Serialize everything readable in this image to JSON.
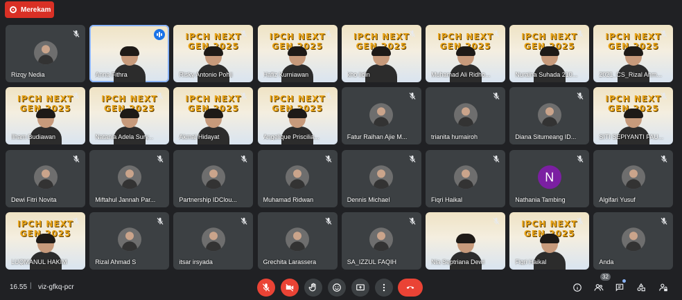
{
  "recording": {
    "label": "Merekam"
  },
  "tiles": [
    {
      "name": "Rizqy Nedia",
      "kind": "avatar",
      "mic": "muted"
    },
    {
      "name": "Anna Fithra",
      "kind": "video",
      "mic": "speaking",
      "active": true
    },
    {
      "name": "Risky Antonio Pohji",
      "kind": "video",
      "mic": "muted",
      "banner": "IPCH NEXT GEN 2025"
    },
    {
      "name": "Hafiz Kurniawan",
      "kind": "video",
      "mic": "muted",
      "banner": "IPCH NEXT GEN 2025"
    },
    {
      "name": "kho iidin",
      "kind": "video",
      "mic": "muted",
      "banner": "IPCH NEXT GEN 2025"
    },
    {
      "name": "Muhamad Ali Ridho...",
      "kind": "video",
      "mic": "muted",
      "banner": "IPCH NEXT GEN 2025"
    },
    {
      "name": "Nuraina Suhada 210...",
      "kind": "video",
      "mic": "muted",
      "banner": "IPCH NEXT GEN 2025"
    },
    {
      "name": "2021_CS_Rizal Ahm...",
      "kind": "video",
      "mic": "muted",
      "banner": "IPCH NEXT GEN 2025"
    },
    {
      "name": "Ilham Budiawan",
      "kind": "video",
      "mic": "muted",
      "banner": "IPCH NEXT GEN 2025"
    },
    {
      "name": "Natania Adela Sury...",
      "kind": "video",
      "mic": "muted",
      "banner": "IPCH NEXT GEN 2025"
    },
    {
      "name": "Akmal Hidayat",
      "kind": "video",
      "mic": "muted",
      "banner": "IPCH NEXT GEN 2025"
    },
    {
      "name": "Angelique Priscilia...",
      "kind": "video",
      "mic": "muted",
      "banner": "IPCH NEXT GEN 2025"
    },
    {
      "name": "Fatur Raihan Ajie M...",
      "kind": "avatar",
      "mic": "muted"
    },
    {
      "name": "trianita humairoh",
      "kind": "avatar",
      "mic": "muted"
    },
    {
      "name": "Diana Situmeang ID...",
      "kind": "avatar",
      "mic": "muted"
    },
    {
      "name": "SITI SEPIYANTI FAU...",
      "kind": "video",
      "mic": "muted",
      "banner": "IPCH NEXT GEN 2025"
    },
    {
      "name": "Dewi Fitri Novita",
      "kind": "avatar",
      "mic": "muted"
    },
    {
      "name": "Miftahul Jannah Par...",
      "kind": "avatar",
      "mic": "muted"
    },
    {
      "name": "Partnership IDClou...",
      "kind": "avatar",
      "mic": "muted"
    },
    {
      "name": "Muhamad Ridwan",
      "kind": "avatar",
      "mic": "muted"
    },
    {
      "name": "Dennis Michael",
      "kind": "avatar",
      "mic": "muted"
    },
    {
      "name": "Fiqri Haikal",
      "kind": "avatar",
      "mic": "muted"
    },
    {
      "name": "Nathania Tambing",
      "kind": "letter",
      "letter": "N",
      "mic": "muted"
    },
    {
      "name": "Algifari Yusuf",
      "kind": "avatar",
      "mic": "muted"
    },
    {
      "name": "LUQMANUL HAKIM",
      "kind": "video",
      "mic": "muted",
      "banner": "IPCH NEXT GEN 2025"
    },
    {
      "name": "Rizal Ahmad S",
      "kind": "avatar",
      "mic": "muted"
    },
    {
      "name": "itsar irsyada",
      "kind": "avatar",
      "mic": "muted"
    },
    {
      "name": "Grechita Larassera",
      "kind": "avatar",
      "mic": "muted"
    },
    {
      "name": "SA_IZZUL FAQIH",
      "kind": "avatar",
      "mic": "muted"
    },
    {
      "name": "Nia Septriana Dewi",
      "kind": "video",
      "mic": "muted"
    },
    {
      "name": "Fiqri Haikal",
      "kind": "video",
      "mic": "muted",
      "banner": "IPCH NEXT GEN 2025"
    },
    {
      "name": "Anda",
      "kind": "avatar",
      "mic": "muted"
    }
  ],
  "bottom": {
    "time": "16.55",
    "separator": "|",
    "meeting_code": "viz-gfkq-pcr",
    "participants_count": "32"
  },
  "colors": {
    "recording": "#d93025",
    "end_call": "#ea4335",
    "active_speaker": "#8ab4f8"
  }
}
